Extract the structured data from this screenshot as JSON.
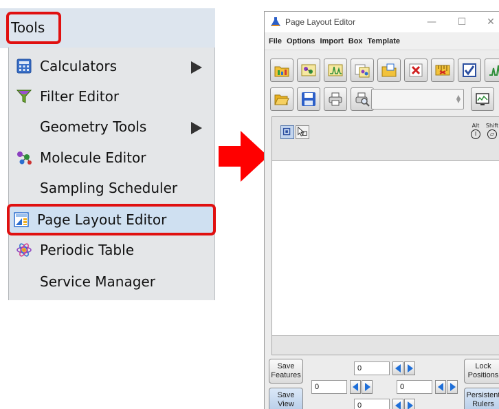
{
  "menu": {
    "title": "Tools",
    "items": [
      {
        "label": "Calculators",
        "icon": "calculator-icon",
        "submenu": true
      },
      {
        "label": "Filter Editor",
        "icon": "filter-icon",
        "submenu": false
      },
      {
        "label": "Geometry Tools",
        "icon": "",
        "submenu": true
      },
      {
        "label": "Molecule Editor",
        "icon": "molecule-icon",
        "submenu": false
      },
      {
        "label": "Sampling Scheduler",
        "icon": "",
        "submenu": false
      },
      {
        "label": "Page Layout Editor",
        "icon": "page-layout-icon",
        "submenu": false,
        "highlighted": true
      },
      {
        "label": "Periodic Table",
        "icon": "atom-icon",
        "submenu": false
      },
      {
        "label": "Service Manager",
        "icon": "",
        "submenu": false
      }
    ]
  },
  "window": {
    "title": "Page Layout Editor",
    "controls": {
      "minimize": "—",
      "maximize": "☐",
      "close": "✕"
    },
    "menus": [
      "File",
      "Options",
      "Import",
      "Box",
      "Template"
    ],
    "combo_value": "",
    "modifiers": [
      {
        "top": "Alt",
        "symbol": "I"
      },
      {
        "top": "Shift",
        "symbol": "⏥"
      }
    ],
    "bottom": {
      "save_features": "Save\nFeatures",
      "save_view": "Save\nView",
      "lock_positions": "Lock\nPositions",
      "persistent_rulers": "Persistent\nRulers",
      "field_top": "0",
      "field_left": "0",
      "field_right": "0",
      "field_bottom": "0"
    }
  },
  "colors": {
    "highlight_border": "#e01010",
    "arrow": "#ff0000",
    "menu_highlight_bg": "#cfe0f1",
    "nav_arrow": "#1f6fd8"
  }
}
